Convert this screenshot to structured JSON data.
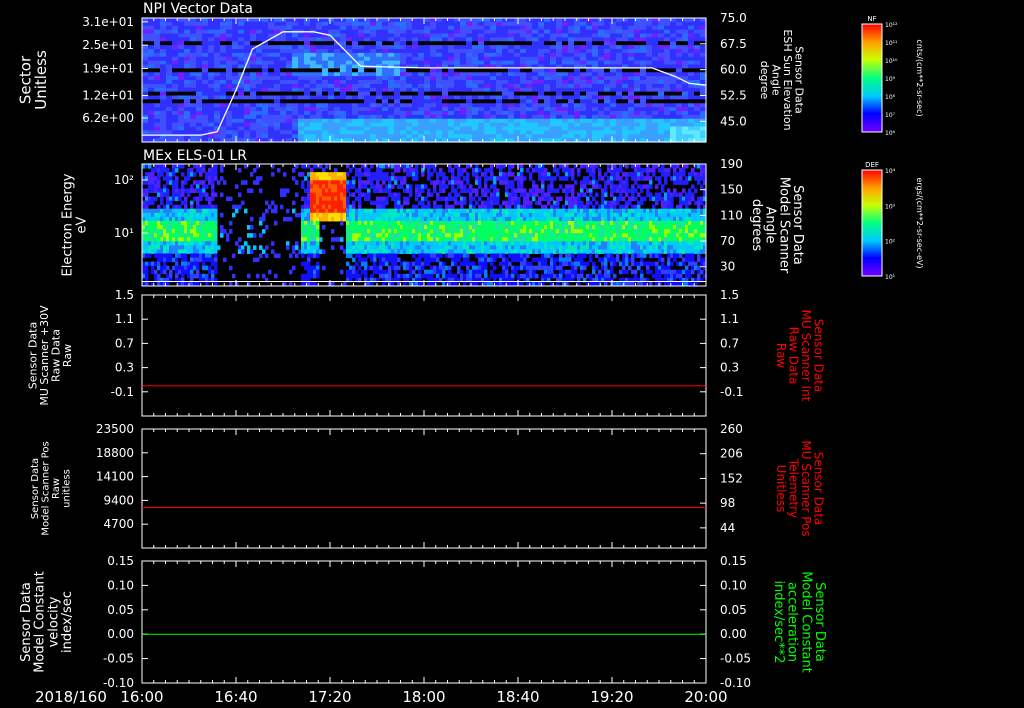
{
  "time_axis": {
    "date_label": "2018/160",
    "tick_labels": [
      "16:00",
      "16:40",
      "17:20",
      "18:00",
      "18:40",
      "19:20",
      "20:00"
    ],
    "start_hour": 16,
    "end_hour": 20
  },
  "colors": {
    "background": "#000000",
    "axis": "#ffffff",
    "red_trace": "#ff0000",
    "green_trace": "#00ff00",
    "elevation_line": "#ffffff"
  },
  "chart_data": [
    {
      "type": "heatmap",
      "title": "NPI Vector Data",
      "ylabel_lines": [
        "Sector",
        "Unitless"
      ],
      "yticks_left": [
        "3.1e+01",
        "2.5e+01",
        "1.9e+01",
        "1.2e+01",
        "6.2e+00"
      ],
      "yticks_left_values": [
        31,
        25,
        19,
        12,
        6.2
      ],
      "ylim_left": [
        0,
        32
      ],
      "ylabel_right_lines": [
        "Sensor Data",
        "ESH Sun Elevation",
        "Angle",
        "degree"
      ],
      "yticks_right": [
        "75.0",
        "67.5",
        "60.0",
        "52.5",
        "45.0"
      ],
      "yticks_right_values": [
        75,
        67.5,
        60,
        52.5,
        45
      ],
      "ylim_right": [
        39,
        75
      ],
      "colorbar": {
        "label": "NF",
        "units": "cnts/(cm**2-sr-sec)",
        "tick_labels": [
          "10¹²",
          "10¹¹",
          "10¹⁰",
          "10⁹",
          "10⁸",
          "10⁷",
          "10⁶"
        ]
      },
      "line_series": {
        "name": "ESH Sun Elevation",
        "x": [
          "16:00",
          "16:25",
          "16:32",
          "16:40",
          "16:47",
          "17:00",
          "17:13",
          "17:20",
          "17:33",
          "18:00",
          "19:20",
          "19:37",
          "19:47",
          "19:53",
          "20:00"
        ],
        "y": [
          41,
          41,
          42,
          54,
          66,
          71,
          71,
          70,
          61,
          60.5,
          60.5,
          60.5,
          58,
          56,
          55.5
        ]
      }
    },
    {
      "type": "heatmap",
      "title": "MEx ELS-01 LR",
      "ylabel_lines": [
        "Electron Energy",
        "eV"
      ],
      "yticks_left": [
        "10²",
        "10¹"
      ],
      "yticks_left_values": [
        100,
        10
      ],
      "ylim_left": [
        1,
        200
      ],
      "ylabel_right_lines": [
        "Sensor Data",
        "Model Scanner",
        "Angle",
        "degrees"
      ],
      "yticks_right": [
        "190",
        "150",
        "110",
        "70",
        "30"
      ],
      "yticks_right_values": [
        190,
        150,
        110,
        70,
        30
      ],
      "ylim_right": [
        0,
        190
      ],
      "colorbar": {
        "label": "DEF",
        "units": "ergs/(cm**2-sr-sec-eV)",
        "tick_labels": [
          "10⁴",
          "10³",
          "10²",
          "10¹"
        ]
      },
      "line_series": {
        "name": "Model Scanner Angle",
        "x": [
          "16:00",
          "20:00"
        ],
        "y": [
          7,
          7
        ]
      }
    },
    {
      "type": "line",
      "ylabel_left_lines": [
        "Sensor Data",
        "MU Scanner +30V",
        "Raw Data",
        "Raw"
      ],
      "yticks_left": [
        "1.5",
        "1.1",
        "0.7",
        "0.3",
        "-0.1"
      ],
      "yticks_left_values": [
        1.5,
        1.1,
        0.7,
        0.3,
        -0.1
      ],
      "ylim_left": [
        -0.5,
        1.5
      ],
      "ylabel_right_lines": [
        "Sensor Data",
        "MU Scanner Int",
        "Raw Data",
        "Raw"
      ],
      "yticks_right": [
        "1.5",
        "1.1",
        "0.7",
        "0.3",
        "-0.1"
      ],
      "yticks_right_values": [
        1.5,
        1.1,
        0.7,
        0.3,
        -0.1
      ],
      "ylim_right": [
        -0.5,
        1.5
      ],
      "right_label_color": "#ff0000",
      "series": [
        {
          "color": "#ff0000",
          "x": [
            "16:00",
            "20:00"
          ],
          "y": [
            0,
            0
          ]
        }
      ]
    },
    {
      "type": "line",
      "ylabel_left_lines": [
        "Sensor Data",
        "Model Scanner Pos",
        "Raw",
        "unitless"
      ],
      "yticks_left": [
        "23500",
        "18800",
        "14100",
        "9400",
        "4700"
      ],
      "yticks_left_values": [
        23500,
        18800,
        14100,
        9400,
        4700
      ],
      "ylim_left": [
        0,
        23500
      ],
      "ylabel_right_lines": [
        "Sensor Data",
        "MU Scanner Pos",
        "Telemetry",
        "Unitless"
      ],
      "yticks_right": [
        "260",
        "206",
        "152",
        "98",
        "44"
      ],
      "yticks_right_values": [
        260,
        206,
        152,
        98,
        44
      ],
      "ylim_right": [
        0,
        260
      ],
      "right_label_color": "#ff0000",
      "series": [
        {
          "color": "#ff0000",
          "x": [
            "16:00",
            "20:00"
          ],
          "y": [
            8000,
            8000
          ]
        }
      ]
    },
    {
      "type": "line",
      "ylabel_left_lines": [
        "Sensor Data",
        "Model Constant",
        "velocity",
        "index/sec"
      ],
      "yticks_left": [
        "0.15",
        "0.10",
        "0.05",
        "0.00",
        "-0.05",
        "-0.10"
      ],
      "yticks_left_values": [
        0.15,
        0.1,
        0.05,
        0.0,
        -0.05,
        -0.1
      ],
      "ylim_left": [
        -0.1,
        0.15
      ],
      "ylabel_right_lines": [
        "Sensor Data",
        "Model Constant",
        "acceleration",
        "index/sec**2"
      ],
      "yticks_right": [
        "0.15",
        "0.10",
        "0.05",
        "0.00",
        "-0.05",
        "-0.10"
      ],
      "yticks_right_values": [
        0.15,
        0.1,
        0.05,
        0.0,
        -0.05,
        -0.1
      ],
      "ylim_right": [
        -0.1,
        0.15
      ],
      "right_label_color": "#00ff00",
      "series": [
        {
          "color": "#00ff00",
          "x": [
            "16:00",
            "20:00"
          ],
          "y": [
            0,
            0
          ]
        }
      ]
    }
  ]
}
